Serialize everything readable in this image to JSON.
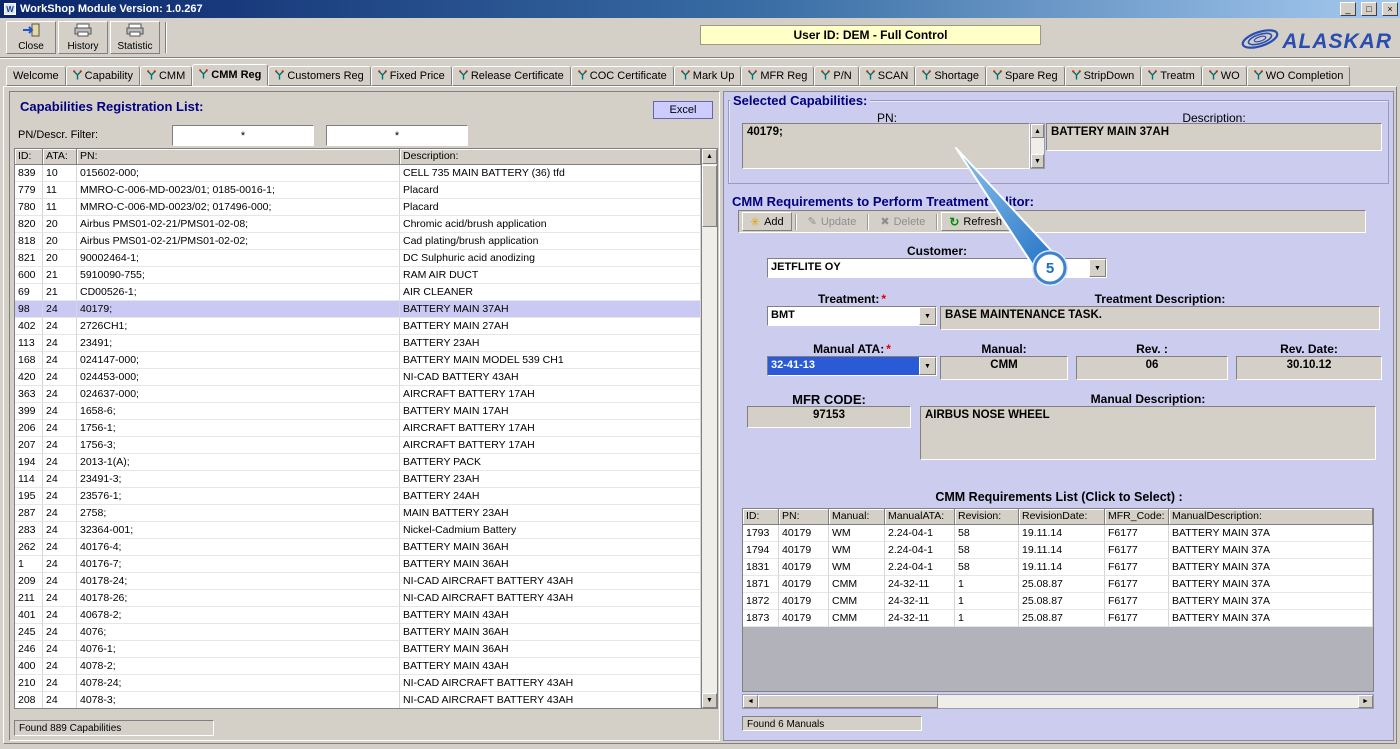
{
  "window": {
    "title": "WorkShop Module  Version: 1.0.267",
    "user_banner": "User ID: DEM - Full Control",
    "brand": "ALASKAR",
    "buttons": {
      "minimize": "_",
      "maximize": "□",
      "close": "×"
    }
  },
  "toolbar": {
    "close": "Close",
    "history": "History",
    "statistic": "Statistic"
  },
  "tabs": {
    "active": "CMM Reg",
    "items": [
      "Welcome",
      "Capability",
      "CMM",
      "CMM Reg",
      "Customers Reg",
      "Fixed Price",
      "Release Certificate",
      "COC Certificate",
      "Mark Up",
      "MFR Reg",
      "P/N",
      "SCAN",
      "Shortage",
      "Spare Reg",
      "StripDown",
      "Treatm",
      "WO",
      "WO Completion"
    ]
  },
  "left_panel": {
    "title": "Capabilities Registration List:",
    "filter_label": "PN/Descr. Filter:",
    "filter1": "*",
    "filter2": "*",
    "excel_button": "Excel",
    "status": "Found 889 Capabilities",
    "table": {
      "headers": [
        "ID:",
        "ATA:",
        "PN:",
        "Description:"
      ],
      "selected_index": 8,
      "rows": [
        [
          "839",
          "10",
          "015602-000;",
          "CELL 735 MAIN BATTERY (36) tfd"
        ],
        [
          "779",
          "11",
          "MMRO-C-006-MD-0023/01; 0185-0016-1;",
          "Placard"
        ],
        [
          "780",
          "11",
          "MMRO-C-006-MD-0023/02; 017496-000;",
          "Placard"
        ],
        [
          "820",
          "20",
          "Airbus PMS01-02-21/PMS01-02-08;",
          "Chromic acid/brush application"
        ],
        [
          "818",
          "20",
          "Airbus PMS01-02-21/PMS01-02-02;",
          "Cad plating/brush application"
        ],
        [
          "821",
          "20",
          "90002464-1;",
          "DC Sulphuric acid anodizing"
        ],
        [
          "600",
          "21",
          "5910090-755;",
          "RAM AIR DUCT"
        ],
        [
          "69",
          "21",
          "CD00526-1;",
          "AIR CLEANER"
        ],
        [
          "98",
          "24",
          "40179;",
          "BATTERY MAIN 37AH"
        ],
        [
          "402",
          "24",
          "2726CH1;",
          "BATTERY MAIN 27AH"
        ],
        [
          "113",
          "24",
          "23491;",
          "BATTERY 23AH"
        ],
        [
          "168",
          "24",
          "024147-000;",
          "BATTERY MAIN MODEL 539 CH1"
        ],
        [
          "420",
          "24",
          "024453-000;",
          "NI-CAD BATTERY 43AH"
        ],
        [
          "363",
          "24",
          "024637-000;",
          "AIRCRAFT BATTERY 17AH"
        ],
        [
          "399",
          "24",
          "1658-6;",
          "BATTERY MAIN 17AH"
        ],
        [
          "206",
          "24",
          "1756-1;",
          "AIRCRAFT BATTERY 17AH"
        ],
        [
          "207",
          "24",
          "1756-3;",
          "AIRCRAFT BATTERY 17AH"
        ],
        [
          "194",
          "24",
          "2013-1(A);",
          "BATTERY PACK"
        ],
        [
          "114",
          "24",
          "23491-3;",
          "BATTERY 23AH"
        ],
        [
          "195",
          "24",
          "23576-1;",
          "BATTERY 24AH"
        ],
        [
          "287",
          "24",
          "2758;",
          "MAIN BATTERY 23AH"
        ],
        [
          "283",
          "24",
          "32364-001;",
          "Nickel-Cadmium Battery"
        ],
        [
          "262",
          "24",
          "40176-4;",
          "BATTERY MAIN 36AH"
        ],
        [
          "1",
          "24",
          "40176-7;",
          "BATTERY MAIN 36AH"
        ],
        [
          "209",
          "24",
          "40178-24;",
          "NI-CAD AIRCRAFT BATTERY 43AH"
        ],
        [
          "211",
          "24",
          "40178-26;",
          "NI-CAD AIRCRAFT BATTERY 43AH"
        ],
        [
          "401",
          "24",
          "40678-2;",
          "BATTERY MAIN 43AH"
        ],
        [
          "245",
          "24",
          "4076;",
          "BATTERY MAIN 36AH"
        ],
        [
          "246",
          "24",
          "4076-1;",
          "BATTERY MAIN 36AH"
        ],
        [
          "400",
          "24",
          "4078-2;",
          "BATTERY MAIN 43AH"
        ],
        [
          "210",
          "24",
          "4078-24;",
          "NI-CAD AIRCRAFT BATTERY 43AH"
        ],
        [
          "208",
          "24",
          "4078-3;",
          "NI-CAD AIRCRAFT BATTERY 43AH"
        ]
      ]
    }
  },
  "selected_capabilities": {
    "title": "Selected Capabilities:",
    "pn_label": "PN:",
    "pn_value": "40179;",
    "description_label": "Description:",
    "description_value": "BATTERY MAIN 37AH"
  },
  "editor": {
    "title": "CMM Requirements to Perform Treatment Editor:",
    "buttons": {
      "add": "Add",
      "update": "Update",
      "delete": "Delete",
      "refresh": "Refresh"
    },
    "required_marker": "*",
    "customer_label": "Customer:",
    "customer_value": "JETFLITE OY",
    "treatment_label": "Treatment:",
    "treatment_value": "BMT",
    "treatment_desc_label": "Treatment Description:",
    "treatment_desc_value": "BASE MAINTENANCE TASK.",
    "manual_ata_label": "Manual ATA:",
    "manual_ata_value": "32-41-13",
    "manual_label": "Manual:",
    "manual_value": "CMM",
    "rev_label": "Rev. :",
    "rev_value": "06",
    "rev_date_label": "Rev. Date:",
    "rev_date_value": "30.10.12",
    "mfr_code_label": "MFR CODE:",
    "mfr_code_value": "97153",
    "manual_desc_label": "Manual Description:",
    "manual_desc_value": "AIRBUS NOSE WHEEL",
    "list_title": "CMM Requirements List (Click to Select) :",
    "status": "Found 6 Manuals",
    "table": {
      "headers": [
        "ID:",
        "PN:",
        "Manual:",
        "ManualATA:",
        "Revision:",
        "RevisionDate:",
        "MFR_Code:",
        "ManualDescription:"
      ],
      "rows": [
        [
          "1793",
          "40179",
          "WM",
          "2.24-04-1",
          "58",
          "19.11.14",
          "F6177",
          "BATTERY MAIN 37A"
        ],
        [
          "1794",
          "40179",
          "WM",
          "2.24-04-1",
          "58",
          "19.11.14",
          "F6177",
          "BATTERY MAIN 37A"
        ],
        [
          "1831",
          "40179",
          "WM",
          "2.24-04-1",
          "58",
          "19.11.14",
          "F6177",
          "BATTERY MAIN 37A"
        ],
        [
          "1871",
          "40179",
          "CMM",
          "24-32-11",
          "1",
          "25.08.87",
          "F6177",
          "BATTERY MAIN 37A"
        ],
        [
          "1872",
          "40179",
          "CMM",
          "24-32-11",
          "1",
          "25.08.87",
          "F6177",
          "BATTERY MAIN 37A"
        ],
        [
          "1873",
          "40179",
          "CMM",
          "24-32-11",
          "1",
          "25.08.87",
          "F6177",
          "BATTERY MAIN 37A"
        ]
      ]
    }
  },
  "callout": {
    "number": "5"
  },
  "colors": {
    "panel_lavender": "#ccccee",
    "selection_row": "#c9c9f3",
    "heading_navy": "#000080",
    "banner_yellow": "#ffffc8",
    "callout_blue": "#2a7fd4",
    "required_red": "#dd0000",
    "brand_blue": "#2a4db0"
  }
}
